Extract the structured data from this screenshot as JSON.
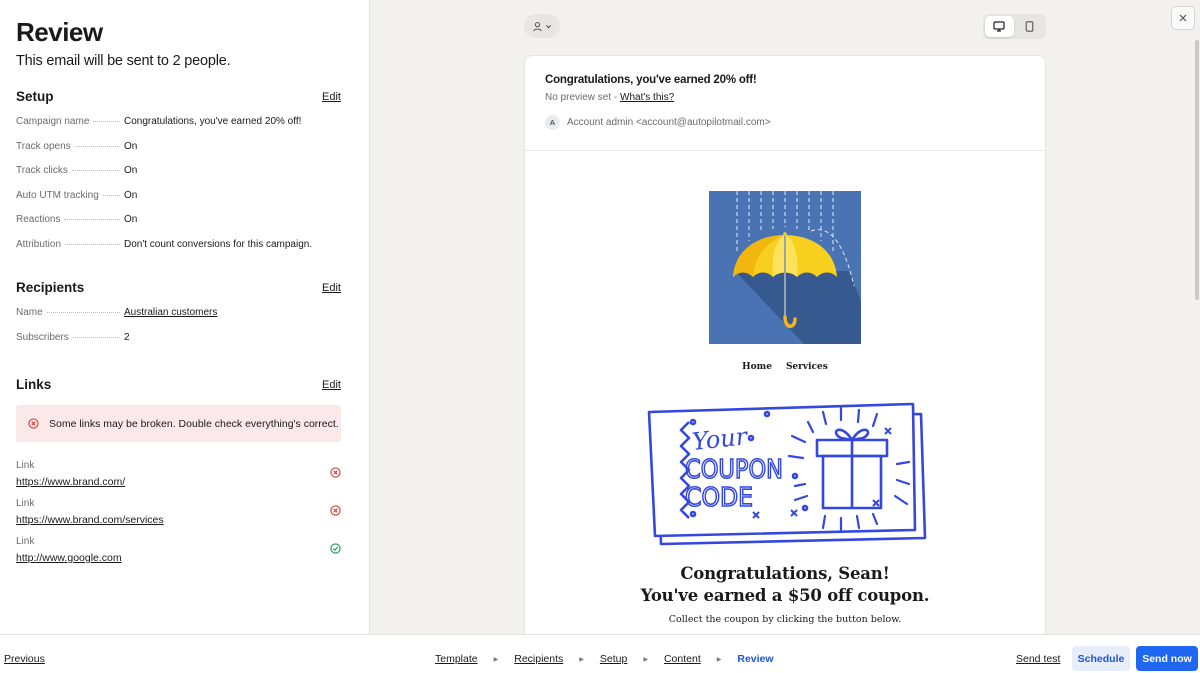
{
  "review": {
    "title": "Review",
    "subtitle": "This email will be sent to 2 people."
  },
  "setup": {
    "title": "Setup",
    "edit_label": "Edit",
    "rows": [
      {
        "key": "Campaign name",
        "value": "Congratulations, you've earned 20% off!"
      },
      {
        "key": "Track opens",
        "value": "On"
      },
      {
        "key": "Track clicks",
        "value": "On"
      },
      {
        "key": "Auto UTM tracking",
        "value": "On"
      },
      {
        "key": "Reactions",
        "value": "On"
      },
      {
        "key": "Attribution",
        "value": "Don't count conversions for this campaign."
      }
    ]
  },
  "recipients": {
    "title": "Recipients",
    "edit_label": "Edit",
    "rows": [
      {
        "key": "Name",
        "value": "Australian customers"
      },
      {
        "key": "Subscribers",
        "value": "2"
      }
    ]
  },
  "links": {
    "title": "Links",
    "edit_label": "Edit",
    "alert": "Some links may be broken. Double check everything's correct.",
    "items": [
      {
        "label": "Link",
        "url": "https://www.brand.com/",
        "status": "error"
      },
      {
        "label": "Link",
        "url": "https://www.brand.com/services",
        "status": "error"
      },
      {
        "label": "Link",
        "url": "http://www.google.com",
        "status": "ok"
      }
    ]
  },
  "email": {
    "subject": "Congratulations, you've earned 20% off!",
    "preview_text": "No preview set - ",
    "preview_link": "What's this?",
    "avatar_letter": "A",
    "from": "Account admin <account@autopilotmail.com>",
    "nav": [
      "Home",
      "Services"
    ],
    "coupon": {
      "word1": "Your",
      "word2": "COUPON",
      "word3": "CODE"
    },
    "headline_1": "Congratulations, Sean!",
    "headline_2": "You've earned a $50 off coupon.",
    "body": "Collect the coupon by clicking the button below."
  },
  "footer": {
    "previous": "Previous",
    "steps": [
      "Template",
      "Recipients",
      "Setup",
      "Content",
      "Review"
    ],
    "active_step": "Review",
    "send_test": "Send test",
    "schedule": "Schedule",
    "send_now": "Send now"
  },
  "colors": {
    "accent": "#1f66f0",
    "error": "#d64545",
    "ok": "#1e9b5a",
    "coupon_blue": "#3448e0"
  }
}
